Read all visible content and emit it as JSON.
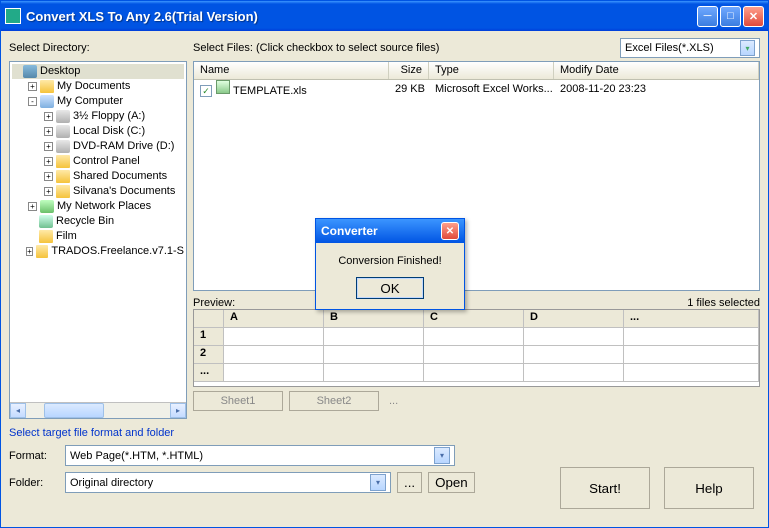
{
  "window": {
    "title": "Convert XLS To Any 2.6(Trial Version)"
  },
  "labels": {
    "select_directory": "Select Directory:",
    "select_files": "Select Files: (Click checkbox to select source files)",
    "preview": "Preview:",
    "files_selected": "1 files selected",
    "target": "Select target file format and folder",
    "format": "Format:",
    "folder": "Folder:"
  },
  "file_filter": "Excel Files(*.XLS)",
  "tree": {
    "items": [
      {
        "indent": 0,
        "exp": "",
        "icon": "i-desktop",
        "label": "Desktop",
        "sel": true
      },
      {
        "indent": 1,
        "exp": "+",
        "icon": "i-folder",
        "label": "My Documents"
      },
      {
        "indent": 1,
        "exp": "-",
        "icon": "i-computer",
        "label": "My Computer"
      },
      {
        "indent": 2,
        "exp": "+",
        "icon": "i-drive",
        "label": "3½ Floppy (A:)"
      },
      {
        "indent": 2,
        "exp": "+",
        "icon": "i-drive",
        "label": "Local Disk (C:)"
      },
      {
        "indent": 2,
        "exp": "+",
        "icon": "i-drive",
        "label": "DVD-RAM Drive (D:)"
      },
      {
        "indent": 2,
        "exp": "+",
        "icon": "i-folder",
        "label": "Control Panel"
      },
      {
        "indent": 2,
        "exp": "+",
        "icon": "i-folder",
        "label": "Shared Documents"
      },
      {
        "indent": 2,
        "exp": "+",
        "icon": "i-folder",
        "label": "Silvana's Documents"
      },
      {
        "indent": 1,
        "exp": "+",
        "icon": "i-network",
        "label": "My Network Places"
      },
      {
        "indent": 1,
        "exp": "",
        "icon": "i-recycle",
        "label": "Recycle Bin"
      },
      {
        "indent": 1,
        "exp": "",
        "icon": "i-folder",
        "label": "Film"
      },
      {
        "indent": 1,
        "exp": "+",
        "icon": "i-folder",
        "label": "TRADOS.Freelance.v7.1-S"
      }
    ]
  },
  "file_cols": {
    "name": "Name",
    "size": "Size",
    "type": "Type",
    "date": "Modify Date"
  },
  "file_rows": [
    {
      "checked": true,
      "name": "TEMPLATE.xls",
      "size": "29 KB",
      "type": "Microsoft Excel Works...",
      "date": "2008-11-20 23:23"
    }
  ],
  "preview_cols": [
    "A",
    "B",
    "C",
    "D",
    "..."
  ],
  "preview_rows": [
    "1",
    "2",
    "..."
  ],
  "sheets": {
    "s1": "Sheet1",
    "s2": "Sheet2",
    "dots": "..."
  },
  "format_combo": "Web Page(*.HTM, *.HTML)",
  "folder_combo": "Original directory",
  "buttons": {
    "browse": "...",
    "open": "Open",
    "start": "Start!",
    "help": "Help"
  },
  "dialog": {
    "title": "Converter",
    "msg": "Conversion Finished!",
    "ok": "OK"
  }
}
